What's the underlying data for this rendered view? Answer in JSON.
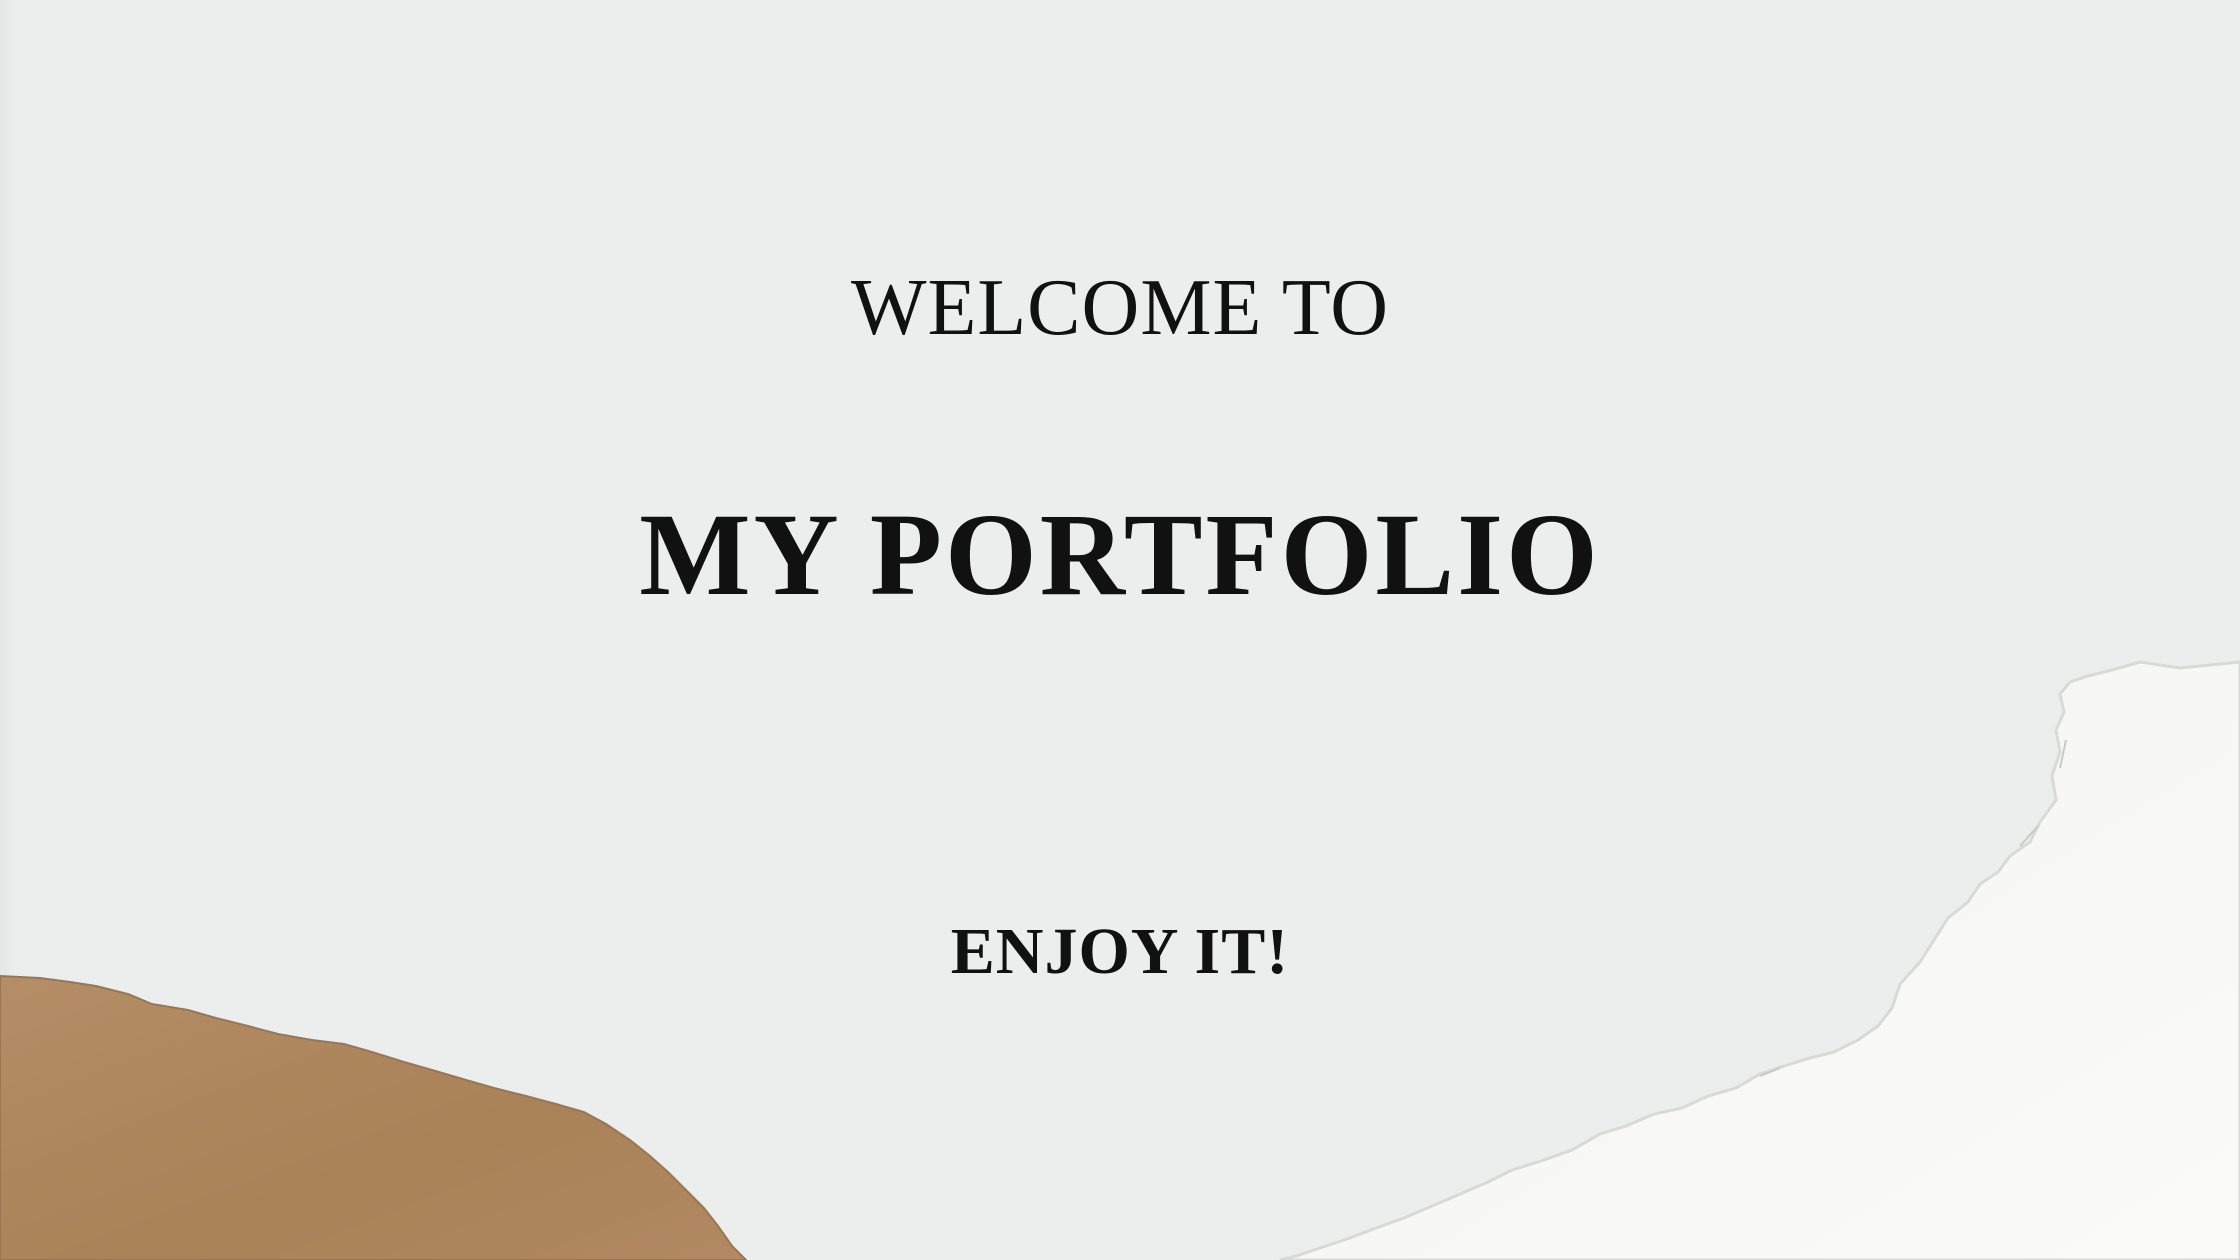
{
  "slide": {
    "welcome": "WELCOME TO",
    "title": "MY PORTFOLIO",
    "tagline": "ENJOY IT!"
  },
  "colors": {
    "background": "#eceeed",
    "text": "#111111",
    "kraft_paper": "#b08a64",
    "white_paper": "#f7f7f5"
  },
  "decorations": [
    "kraft-paper-torn-piece",
    "white-paper-torn-piece"
  ]
}
